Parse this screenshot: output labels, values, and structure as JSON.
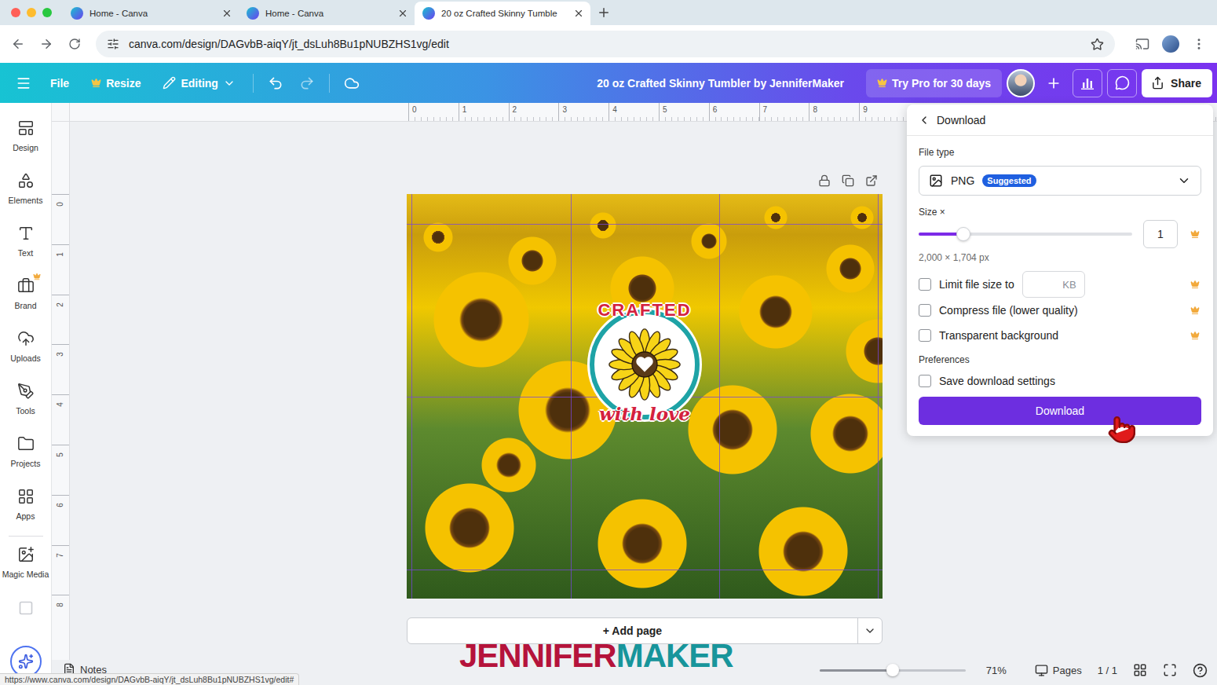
{
  "browser": {
    "tabs": [
      {
        "label": "Home - Canva",
        "selected": false
      },
      {
        "label": "Home - Canva",
        "selected": false
      },
      {
        "label": "20 oz Crafted Skinny Tumble",
        "selected": true
      }
    ],
    "address": "canva.com/design/DAGvbB-aiqY/jt_dsLuh8Bu1pNUBZHS1vg/edit"
  },
  "header": {
    "file": "File",
    "resize": "Resize",
    "editing": "Editing",
    "title": "20 oz Crafted Skinny Tumbler by JenniferMaker",
    "pro": "Try Pro for 30 days",
    "share": "Share"
  },
  "sidebar": {
    "items": [
      {
        "label": "Design",
        "pro": false
      },
      {
        "label": "Elements",
        "pro": false
      },
      {
        "label": "Text",
        "pro": false
      },
      {
        "label": "Brand",
        "pro": true
      },
      {
        "label": "Uploads",
        "pro": false
      },
      {
        "label": "Tools",
        "pro": false
      },
      {
        "label": "Projects",
        "pro": false
      },
      {
        "label": "Apps",
        "pro": false
      },
      {
        "label": "Magic Media",
        "pro": false
      }
    ]
  },
  "rulers": {
    "horizontal": [
      "0",
      "1",
      "2",
      "3",
      "4",
      "5",
      "6",
      "7",
      "8",
      "9"
    ],
    "vertical": [
      "0",
      "1",
      "2",
      "3",
      "4",
      "5",
      "6",
      "7",
      "8"
    ]
  },
  "design": {
    "badge_top": "CRAFTED",
    "badge_bottom": "with love"
  },
  "add_page": "+ Add page",
  "download": {
    "title": "Download",
    "file_type": {
      "label": "File type",
      "value": "PNG",
      "badge": "Suggested"
    },
    "size": {
      "label": "Size ×",
      "level": 0.21,
      "value": "1",
      "pro": true,
      "dimensions": "2,000 × 1,704 px"
    },
    "options": [
      {
        "label": "Limit file size to",
        "kind": "input",
        "unit": "KB",
        "checked": false,
        "pro": true
      },
      {
        "label": "Compress file (lower quality)",
        "kind": "plain",
        "checked": false,
        "pro": true
      },
      {
        "label": "Transparent background",
        "kind": "plain",
        "checked": false,
        "pro": true
      }
    ],
    "preferences": {
      "label": "Preferences",
      "options": [
        {
          "label": "Save download settings",
          "kind": "plain",
          "checked": false,
          "pro": false
        }
      ]
    },
    "button": "Download"
  },
  "bottom_bar": {
    "notes": "Notes",
    "zoom": {
      "level": 0.5,
      "reading": "71%"
    },
    "pages": "Pages",
    "page_count": "1 / 1"
  },
  "watermark": [
    {
      "text": "JENNIFER",
      "color": "#b5133b"
    },
    {
      "text": "MAKER",
      "color": "#17959b"
    }
  ],
  "status_url": "https://www.canva.com/design/DAGvbB-aiqY/jt_dsLuh8Bu1pNUBZHS1vg/edit#"
}
